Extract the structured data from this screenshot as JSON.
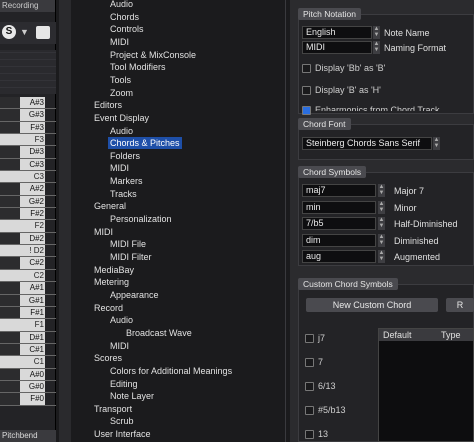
{
  "left": {
    "recording_label": "Recording",
    "s_button": "S",
    "dropdown_arrow": "▼",
    "pitchbend_label": "Pitchbend",
    "keys": [
      {
        "label": "A#3",
        "black": true
      },
      {
        "label": "G#3",
        "black": true
      },
      {
        "label": "F#3",
        "black": true
      },
      {
        "label": "F3",
        "black": false
      },
      {
        "label": "D#3",
        "black": true
      },
      {
        "label": "C#3",
        "black": true
      },
      {
        "label": "C3",
        "black": false
      },
      {
        "label": "A#2",
        "black": true
      },
      {
        "label": "G#2",
        "black": true
      },
      {
        "label": "F#2",
        "black": true
      },
      {
        "label": "F2",
        "black": false
      },
      {
        "label": "D#2",
        "black": true
      },
      {
        "label": "! D2",
        "black": false
      },
      {
        "label": "C#2",
        "black": true
      },
      {
        "label": "C2",
        "black": false
      },
      {
        "label": "A#1",
        "black": true
      },
      {
        "label": "G#1",
        "black": true
      },
      {
        "label": "F#1",
        "black": true
      },
      {
        "label": "F1",
        "black": false
      },
      {
        "label": "D#1",
        "black": true
      },
      {
        "label": "C#1",
        "black": true
      },
      {
        "label": "C1",
        "black": false
      },
      {
        "label": "A#0",
        "black": true
      },
      {
        "label": "G#0",
        "black": true
      },
      {
        "label": "F#0",
        "black": true
      }
    ]
  },
  "tree": {
    "items": [
      {
        "label": "Audio",
        "indent": 2
      },
      {
        "label": "Chords",
        "indent": 2
      },
      {
        "label": "Controls",
        "indent": 2
      },
      {
        "label": "MIDI",
        "indent": 2
      },
      {
        "label": "Project & MixConsole",
        "indent": 2
      },
      {
        "label": "Tool Modifiers",
        "indent": 2
      },
      {
        "label": "Tools",
        "indent": 2
      },
      {
        "label": "Zoom",
        "indent": 2
      },
      {
        "label": "Editors",
        "indent": 1
      },
      {
        "label": "Event Display",
        "indent": 1
      },
      {
        "label": "Audio",
        "indent": 2
      },
      {
        "label": "Chords & Pitches",
        "indent": 2,
        "selected": true
      },
      {
        "label": "Folders",
        "indent": 2
      },
      {
        "label": "MIDI",
        "indent": 2
      },
      {
        "label": "Markers",
        "indent": 2
      },
      {
        "label": "Tracks",
        "indent": 2
      },
      {
        "label": "General",
        "indent": 1
      },
      {
        "label": "Personalization",
        "indent": 2
      },
      {
        "label": "MIDI",
        "indent": 1
      },
      {
        "label": "MIDI File",
        "indent": 2
      },
      {
        "label": "MIDI Filter",
        "indent": 2
      },
      {
        "label": "MediaBay",
        "indent": 1
      },
      {
        "label": "Metering",
        "indent": 1
      },
      {
        "label": "Appearance",
        "indent": 2
      },
      {
        "label": "Record",
        "indent": 1
      },
      {
        "label": "Audio",
        "indent": 2
      },
      {
        "label": "Broadcast Wave",
        "indent": 3
      },
      {
        "label": "MIDI",
        "indent": 2
      },
      {
        "label": "Scores",
        "indent": 1
      },
      {
        "label": "Colors for Additional Meanings",
        "indent": 2
      },
      {
        "label": "Editing",
        "indent": 2
      },
      {
        "label": "Note Layer",
        "indent": 2
      },
      {
        "label": "Transport",
        "indent": 1
      },
      {
        "label": "Scrub",
        "indent": 2
      },
      {
        "label": "User Interface",
        "indent": 1
      }
    ]
  },
  "pitch_notation": {
    "title": "Pitch Notation",
    "note_name_value": "English",
    "note_name_label": "Note Name",
    "naming_format_value": "MIDI",
    "naming_format_label": "Naming Format",
    "display_bb_label": "Display 'Bb' as 'B'",
    "display_b_label": "Display 'B' as 'H'",
    "enharmonics_label": "Enharmonics from Chord Track"
  },
  "chord_font": {
    "title": "Chord Font",
    "value": "Steinberg Chords Sans Serif"
  },
  "chord_symbols": {
    "title": "Chord Symbols",
    "rows": [
      {
        "value": "maj7",
        "label": "Major 7"
      },
      {
        "value": "min",
        "label": "Minor"
      },
      {
        "value": "7/b5",
        "label": "Half-Diminished"
      },
      {
        "value": "dim",
        "label": "Diminished"
      },
      {
        "value": "aug",
        "label": "Augmented"
      }
    ]
  },
  "custom_chords": {
    "title": "Custom Chord Symbols",
    "new_button": "New Custom Chord",
    "second_button": "R",
    "checkboxes": [
      "j7",
      "7",
      "6/13",
      "#5/b13",
      "13"
    ],
    "table_headers": [
      "Default",
      "Type"
    ]
  }
}
